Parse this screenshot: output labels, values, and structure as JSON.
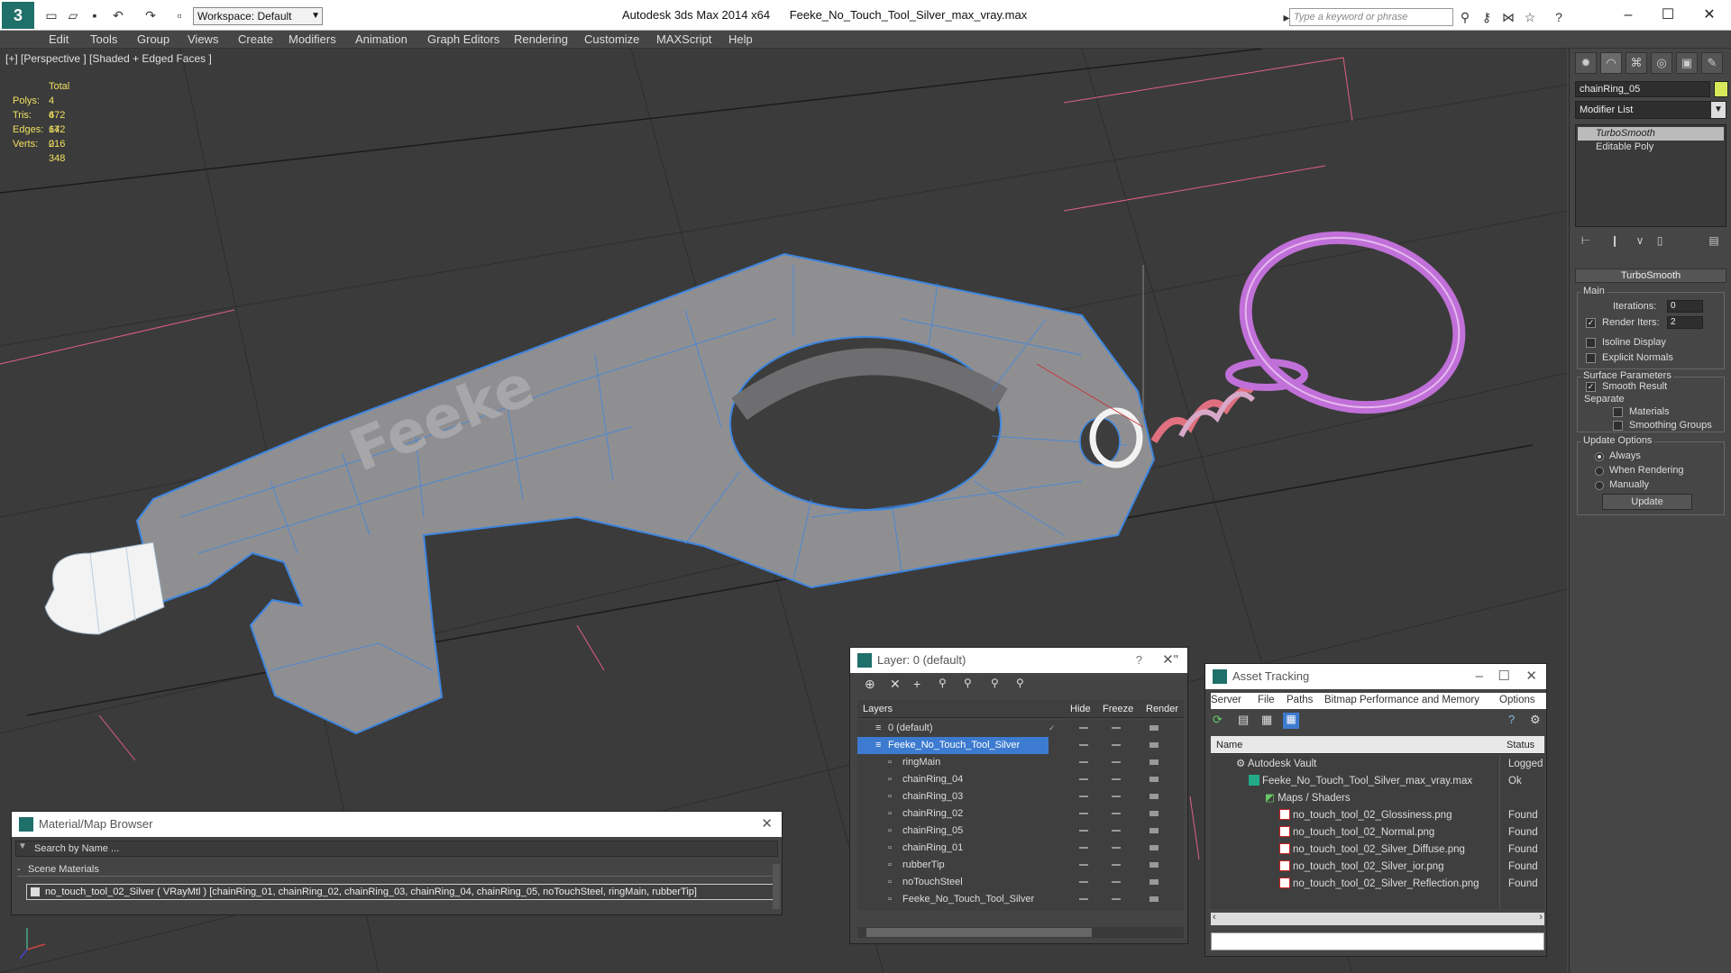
{
  "app": {
    "title": "Autodesk 3ds Max  2014 x64",
    "file": "Feeke_No_Touch_Tool_Silver_max_vray.max",
    "logo": "3",
    "workspace": "Workspace: Default",
    "search_placeholder": "Type a keyword or phrase"
  },
  "menu": [
    "Edit",
    "Tools",
    "Group",
    "Views",
    "Create",
    "Modifiers",
    "Animation",
    "Graph Editors",
    "Rendering",
    "Customize",
    "MAXScript",
    "Help"
  ],
  "viewport": {
    "label": "[+] [Perspective ] [Shaded + Edged Faces ]",
    "stats": {
      "total_label": "Total",
      "rows": [
        {
          "label": "Polys:",
          "value": "4 672"
        },
        {
          "label": "Tris:",
          "value": "4 672"
        },
        {
          "label": "Edges:",
          "value": "14 016"
        },
        {
          "label": "Verts:",
          "value": "2 348"
        }
      ]
    },
    "model_text": "Feeke"
  },
  "command_panel": {
    "object_name": "chainRing_05",
    "object_color": "#d7e85a",
    "modifier_list": "Modifier List",
    "stack": [
      "TurboSmooth",
      "Editable Poly"
    ],
    "rollout_title": "TurboSmooth",
    "main_group": "Main",
    "iterations_label": "Iterations:",
    "iterations_value": "0",
    "render_iters_label": "Render Iters:",
    "render_iters_value": "2",
    "isoline_label": "Isoline Display",
    "explicit_label": "Explicit Normals",
    "surface_group": "Surface Parameters",
    "smooth_result": "Smooth Result",
    "separate_label": "Separate",
    "materials_label": "Materials",
    "smoothing_label": "Smoothing Groups",
    "update_group": "Update Options",
    "always": "Always",
    "when_rendering": "When Rendering",
    "manually": "Manually",
    "update_btn": "Update"
  },
  "material_browser": {
    "title": "Material/Map Browser",
    "search": "Search by Name ...",
    "section": "Scene Materials",
    "material": "no_touch_tool_02_Silver  ( VRayMtl )  [chainRing_01, chainRing_02, chainRing_03, chainRing_04, chainRing_05, noTouchSteel, ringMain, rubberTip]"
  },
  "layer_window": {
    "title": "Layer: 0 (default)",
    "help": "?",
    "columns": [
      "Layers",
      "Hide",
      "Freeze",
      "Render"
    ],
    "rows": [
      {
        "name": "0 (default)",
        "indent": 1,
        "selected": false
      },
      {
        "name": "Feeke_No_Touch_Tool_Silver",
        "indent": 1,
        "selected": true
      },
      {
        "name": "ringMain",
        "indent": 2,
        "selected": false
      },
      {
        "name": "chainRing_04",
        "indent": 2,
        "selected": false
      },
      {
        "name": "chainRing_03",
        "indent": 2,
        "selected": false
      },
      {
        "name": "chainRing_02",
        "indent": 2,
        "selected": false
      },
      {
        "name": "chainRing_05",
        "indent": 2,
        "selected": false
      },
      {
        "name": "chainRing_01",
        "indent": 2,
        "selected": false
      },
      {
        "name": "rubberTip",
        "indent": 2,
        "selected": false
      },
      {
        "name": "noTouchSteel",
        "indent": 2,
        "selected": false
      },
      {
        "name": "Feeke_No_Touch_Tool_Silver",
        "indent": 2,
        "selected": false
      }
    ]
  },
  "asset_tracking": {
    "title": "Asset Tracking",
    "menu": [
      "Server",
      "File",
      "Paths",
      "Bitmap Performance and Memory",
      "Options"
    ],
    "columns": [
      "Name",
      "Status"
    ],
    "rows": [
      {
        "name": "Autodesk Vault",
        "status": "Logged O",
        "indent": 1,
        "icon": "vault"
      },
      {
        "name": "Feeke_No_Touch_Tool_Silver_max_vray.max",
        "status": "Ok",
        "indent": 2,
        "icon": "max"
      },
      {
        "name": "Maps / Shaders",
        "status": "",
        "indent": 3,
        "icon": "folder"
      },
      {
        "name": "no_touch_tool_02_Glossiness.png",
        "status": "Found",
        "indent": 4,
        "icon": "png"
      },
      {
        "name": "no_touch_tool_02_Normal.png",
        "status": "Found",
        "indent": 4,
        "icon": "png"
      },
      {
        "name": "no_touch_tool_02_Silver_Diffuse.png",
        "status": "Found",
        "indent": 4,
        "icon": "png"
      },
      {
        "name": "no_touch_tool_02_Silver_ior.png",
        "status": "Found",
        "indent": 4,
        "icon": "png"
      },
      {
        "name": "no_touch_tool_02_Silver_Reflection.png",
        "status": "Found",
        "indent": 4,
        "icon": "png"
      }
    ]
  }
}
